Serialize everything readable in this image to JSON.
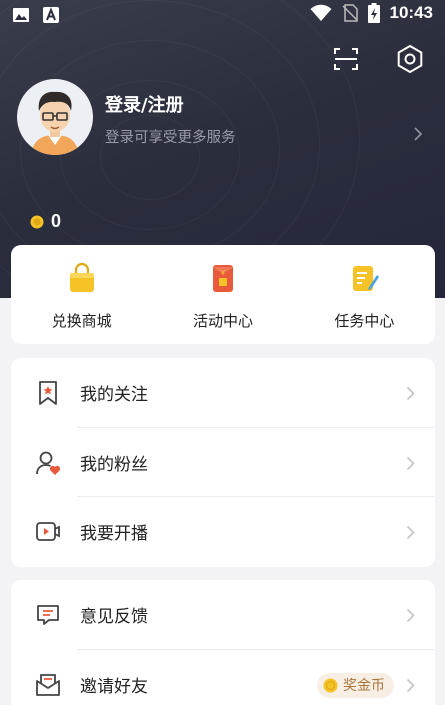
{
  "status_bar": {
    "time": "10:43"
  },
  "profile": {
    "login_label": "登录/注册",
    "login_hint": "登录可享受更多服务",
    "coin_count": "0"
  },
  "quick_actions": [
    {
      "label": "兑换商城",
      "icon": "shopping-bag-icon"
    },
    {
      "label": "活动中心",
      "icon": "red-envelope-icon"
    },
    {
      "label": "任务中心",
      "icon": "task-note-icon"
    }
  ],
  "menu_group_1": [
    {
      "label": "我的关注",
      "icon": "bookmark-star-icon"
    },
    {
      "label": "我的粉丝",
      "icon": "user-heart-icon"
    },
    {
      "label": "我要开播",
      "icon": "live-video-icon"
    }
  ],
  "menu_group_2": [
    {
      "label": "意见反馈",
      "icon": "feedback-message-icon"
    },
    {
      "label": "邀请好友",
      "icon": "invite-envelope-icon",
      "badge": "奖金币"
    }
  ],
  "colors": {
    "header_dark": "#2b2e3c",
    "accent_gold": "#f5c327",
    "accent_red": "#e95a3c"
  }
}
